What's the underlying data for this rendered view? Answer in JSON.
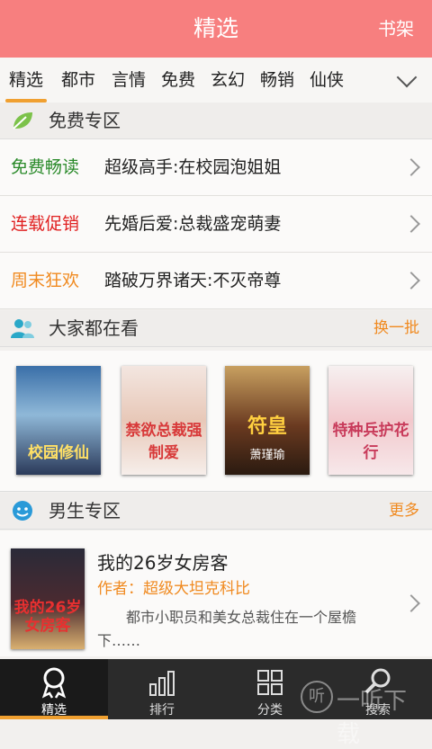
{
  "header": {
    "title": "精选",
    "shelf_label": "书架"
  },
  "tabs": [
    {
      "label": "精选",
      "active": true
    },
    {
      "label": "都市"
    },
    {
      "label": "言情"
    },
    {
      "label": "免费"
    },
    {
      "label": "玄幻"
    },
    {
      "label": "畅销"
    },
    {
      "label": "仙侠"
    }
  ],
  "free_zone": {
    "title": "免费专区",
    "icon": "leaf-icon",
    "rows": [
      {
        "tag": "免费畅读",
        "tag_color": "#2a8a2a",
        "text": "超级高手:在校园泡姐姐"
      },
      {
        "tag": "连载促销",
        "tag_color": "#e02020",
        "text": "先婚后爱:总裁盛宠萌妻"
      },
      {
        "tag": "周末狂欢",
        "tag_color": "#f08a20",
        "text": "踏破万界诸天:不灭帝尊"
      }
    ]
  },
  "popular": {
    "title": "大家都在看",
    "action": "换一批",
    "icon": "people-icon",
    "covers": [
      {
        "title": "校园修仙"
      },
      {
        "title": "禁欲总裁强制爱"
      },
      {
        "title": "符皇",
        "author": "萧瑾瑜"
      },
      {
        "title": "特种兵护花行"
      }
    ]
  },
  "male_zone": {
    "title": "男生专区",
    "action": "更多",
    "icon": "smiley-icon",
    "book": {
      "title": "我的26岁女房客",
      "author_label": "作者：",
      "author": "超级大坦克科比",
      "desc": "都市小职员和美女总裁住在一个屋檐下……",
      "cover_title": "我的26岁女房客"
    }
  },
  "bottom_nav": [
    {
      "label": "精选",
      "icon": "award-icon",
      "active": true
    },
    {
      "label": "排行",
      "icon": "bar-chart-icon"
    },
    {
      "label": "分类",
      "icon": "grid-icon"
    },
    {
      "label": "搜索",
      "icon": "search-icon"
    }
  ],
  "watermark": {
    "text": "一听下载",
    "glyph": "听"
  },
  "colors": {
    "header": "#f77f7f",
    "accent": "#f08a20",
    "green": "#2a8a2a",
    "red": "#e02020"
  }
}
